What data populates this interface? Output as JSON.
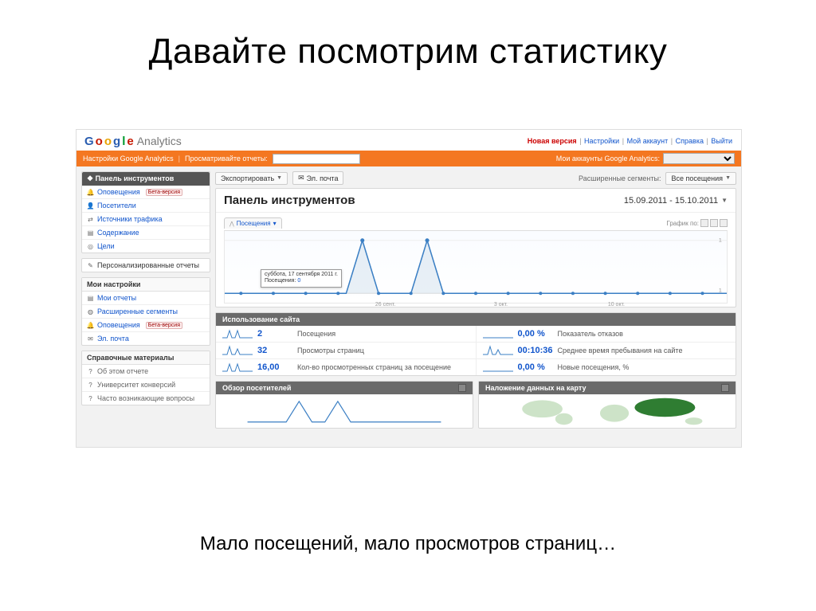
{
  "slide": {
    "title": "Давайте посмотрим статистику",
    "caption": "Мало посещений, мало просмотров страниц…"
  },
  "logo": {
    "g": "G",
    "o1": "o",
    "o2": "o",
    "g2": "g",
    "l": "l",
    "e": "e",
    "analytics": "Analytics"
  },
  "toplinks": {
    "new_version": "Новая версия",
    "settings": "Настройки",
    "my_account": "Мой аккаунт",
    "help": "Справка",
    "logout": "Выйти"
  },
  "orange": {
    "settings_ga": "Настройки Google Analytics",
    "view_reports": "Просматривайте отчеты:",
    "my_accounts": "Мои аккаунты Google Analytics:"
  },
  "sidebar": {
    "panel_dashboard": "Панель инструментов",
    "items": [
      {
        "icon": "bell",
        "label": "Оповещения",
        "beta": "Бета-версия"
      },
      {
        "icon": "user",
        "label": "Посетители"
      },
      {
        "icon": "arrows",
        "label": "Источники трафика"
      },
      {
        "icon": "doc",
        "label": "Содержание"
      },
      {
        "icon": "target",
        "label": "Цели"
      }
    ],
    "custom_reports": "Персонализированные отчеты",
    "my_settings_head": "Мои настройки",
    "my_settings": [
      {
        "icon": "doc",
        "label": "Мои отчеты"
      },
      {
        "icon": "seg",
        "label": "Расширенные сегменты"
      },
      {
        "icon": "bell",
        "label": "Оповещения",
        "beta": "Бета-версия"
      },
      {
        "icon": "mail",
        "label": "Эл. почта"
      }
    ],
    "help_head": "Справочные материалы",
    "help_items": [
      {
        "icon": "q",
        "label": "Об этом отчете"
      },
      {
        "icon": "q",
        "label": "Университет конверсий"
      },
      {
        "icon": "q",
        "label": "Часто возникающие вопросы"
      }
    ]
  },
  "toolbar": {
    "export": "Экспортировать",
    "email": "Эл. почта",
    "adv_seg": "Расширенные сегменты:",
    "all_visits": "Все посещения"
  },
  "dashboard": {
    "title": "Панель инструментов",
    "date_range": "15.09.2011 - 15.10.2011",
    "tab_visits": "Посещения",
    "graph_by": "График по:",
    "tooltip_date": "суббота, 17 сентября 2011 г.",
    "tooltip_metric": "Посещения:",
    "tooltip_value": "0",
    "xlabels": {
      "a": "26 сент.",
      "b": "3 окт.",
      "c": "10 окт."
    },
    "y1": "1",
    "y0": "1"
  },
  "site_usage": {
    "head": "Использование сайта",
    "left": [
      {
        "val": "2",
        "lbl": "Посещения"
      },
      {
        "val": "32",
        "lbl": "Просмотры страниц"
      },
      {
        "val": "16,00",
        "lbl": "Кол-во просмотренных страниц за посещение"
      }
    ],
    "right": [
      {
        "val": "0,00 %",
        "lbl": "Показатель отказов"
      },
      {
        "val": "00:10:36",
        "lbl": "Среднее время пребывания на сайте"
      },
      {
        "val": "0,00 %",
        "lbl": "Новые посещения, %"
      }
    ]
  },
  "bottom": {
    "visitors_overview": "Обзор посетителей",
    "map_overlay": "Наложение данных на карту"
  },
  "chart_data": {
    "type": "line",
    "title": "Посещения",
    "x_range": [
      "15.09.2011",
      "15.10.2011"
    ],
    "series": [
      {
        "name": "Посещения",
        "values": [
          0,
          0,
          0,
          0,
          0,
          0,
          0,
          1,
          0,
          0,
          0,
          1,
          0,
          0,
          0,
          0,
          0,
          0,
          0,
          0,
          0,
          0,
          0,
          0,
          0,
          0,
          0,
          0,
          0,
          0,
          0
        ]
      }
    ],
    "ylim": [
      0,
      1
    ]
  }
}
